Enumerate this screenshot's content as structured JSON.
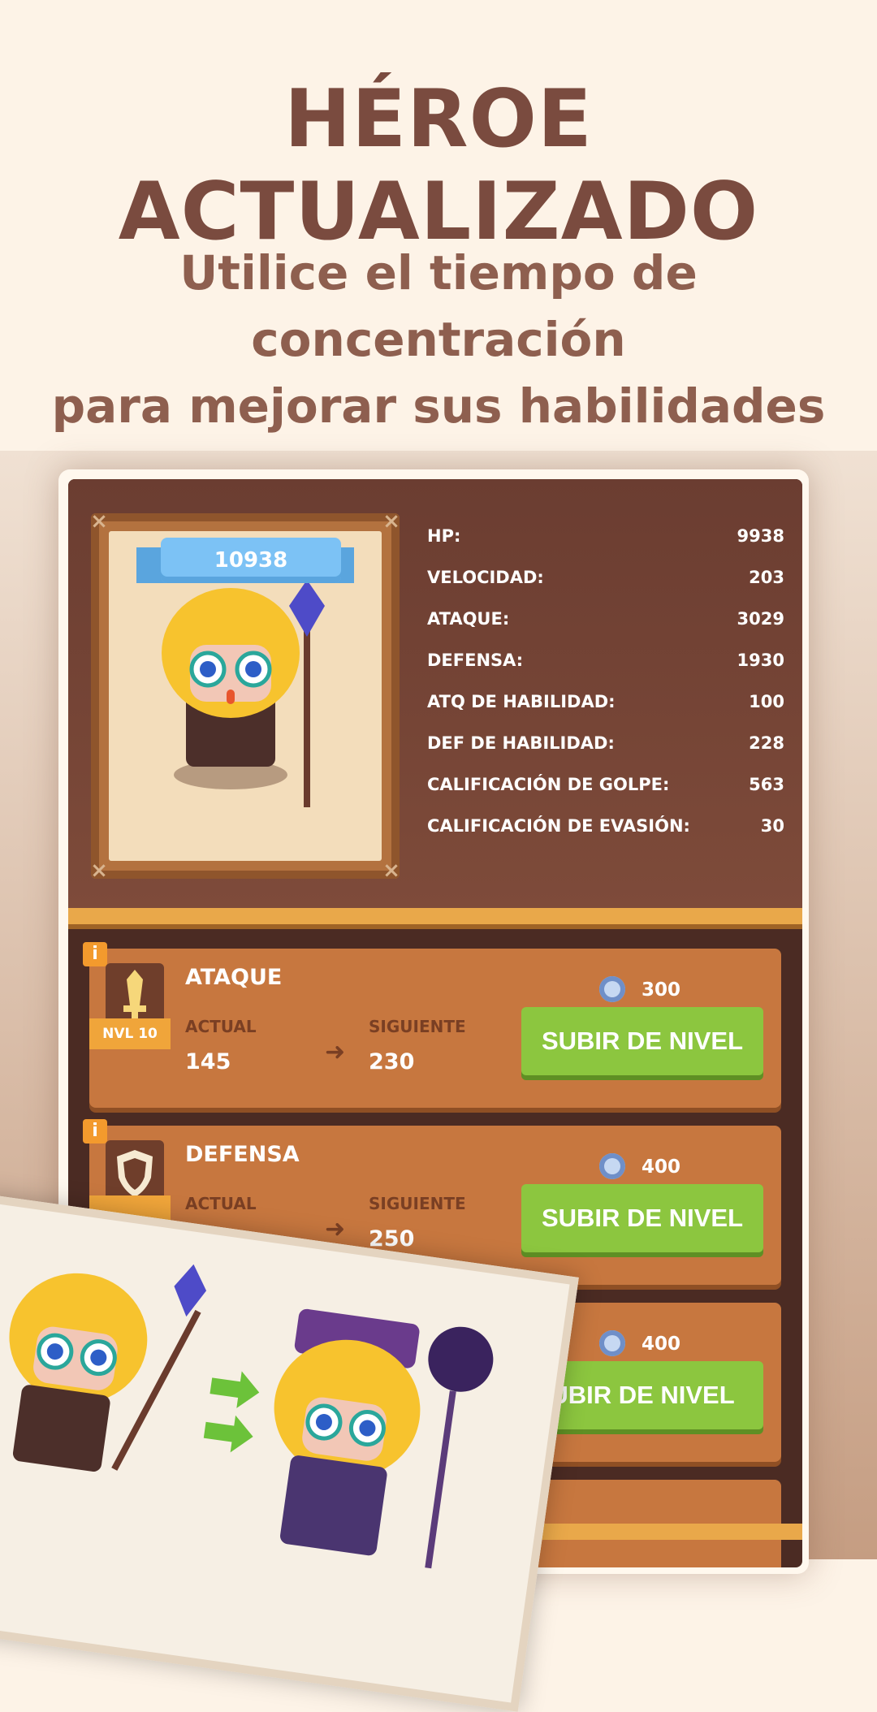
{
  "headline": "HÉROE ACTUALIZADO",
  "subtitle": [
    "Utilice el tiempo de concentración",
    "para mejorar sus habilidades"
  ],
  "hero": {
    "power": "10938",
    "stats": [
      {
        "label": "HP:",
        "value": "9938"
      },
      {
        "label": "VELOCIDAD:",
        "value": "203"
      },
      {
        "label": "ATAQUE:",
        "value": "3029"
      },
      {
        "label": "DEFENSA:",
        "value": "1930"
      },
      {
        "label": "ATQ DE HABILIDAD:",
        "value": "100"
      },
      {
        "label": "DEF DE HABILIDAD:",
        "value": "228"
      },
      {
        "label": "CALIFICACIÓN DE GOLPE:",
        "value": "563"
      },
      {
        "label": "CALIFICACIÓN DE EVASIÓN:",
        "value": "30"
      }
    ]
  },
  "upgrades": [
    {
      "title": "ATAQUE",
      "level": "NVL 10",
      "current_label": "ACTUAL",
      "current": "145",
      "next_label": "SIGUIENTE",
      "next": "230",
      "cost": "300",
      "button": "SUBIR DE NIVEL",
      "icon": "sword-icon"
    },
    {
      "title": "DEFENSA",
      "level": "",
      "current_label": "ACTUAL",
      "current": "",
      "next_label": "SIGUIENTE",
      "next": "250",
      "cost": "400",
      "button": "SUBIR DE NIVEL",
      "icon": "shield-icon"
    },
    {
      "cost": "400",
      "button_partial": "UBIR DE NIVEL"
    }
  ],
  "colors": {
    "brand_brown": "#7a4b3f",
    "button_green": "#8cc63f",
    "card_orange": "#c7773f",
    "ribbon_blue": "#7cc2f5"
  }
}
